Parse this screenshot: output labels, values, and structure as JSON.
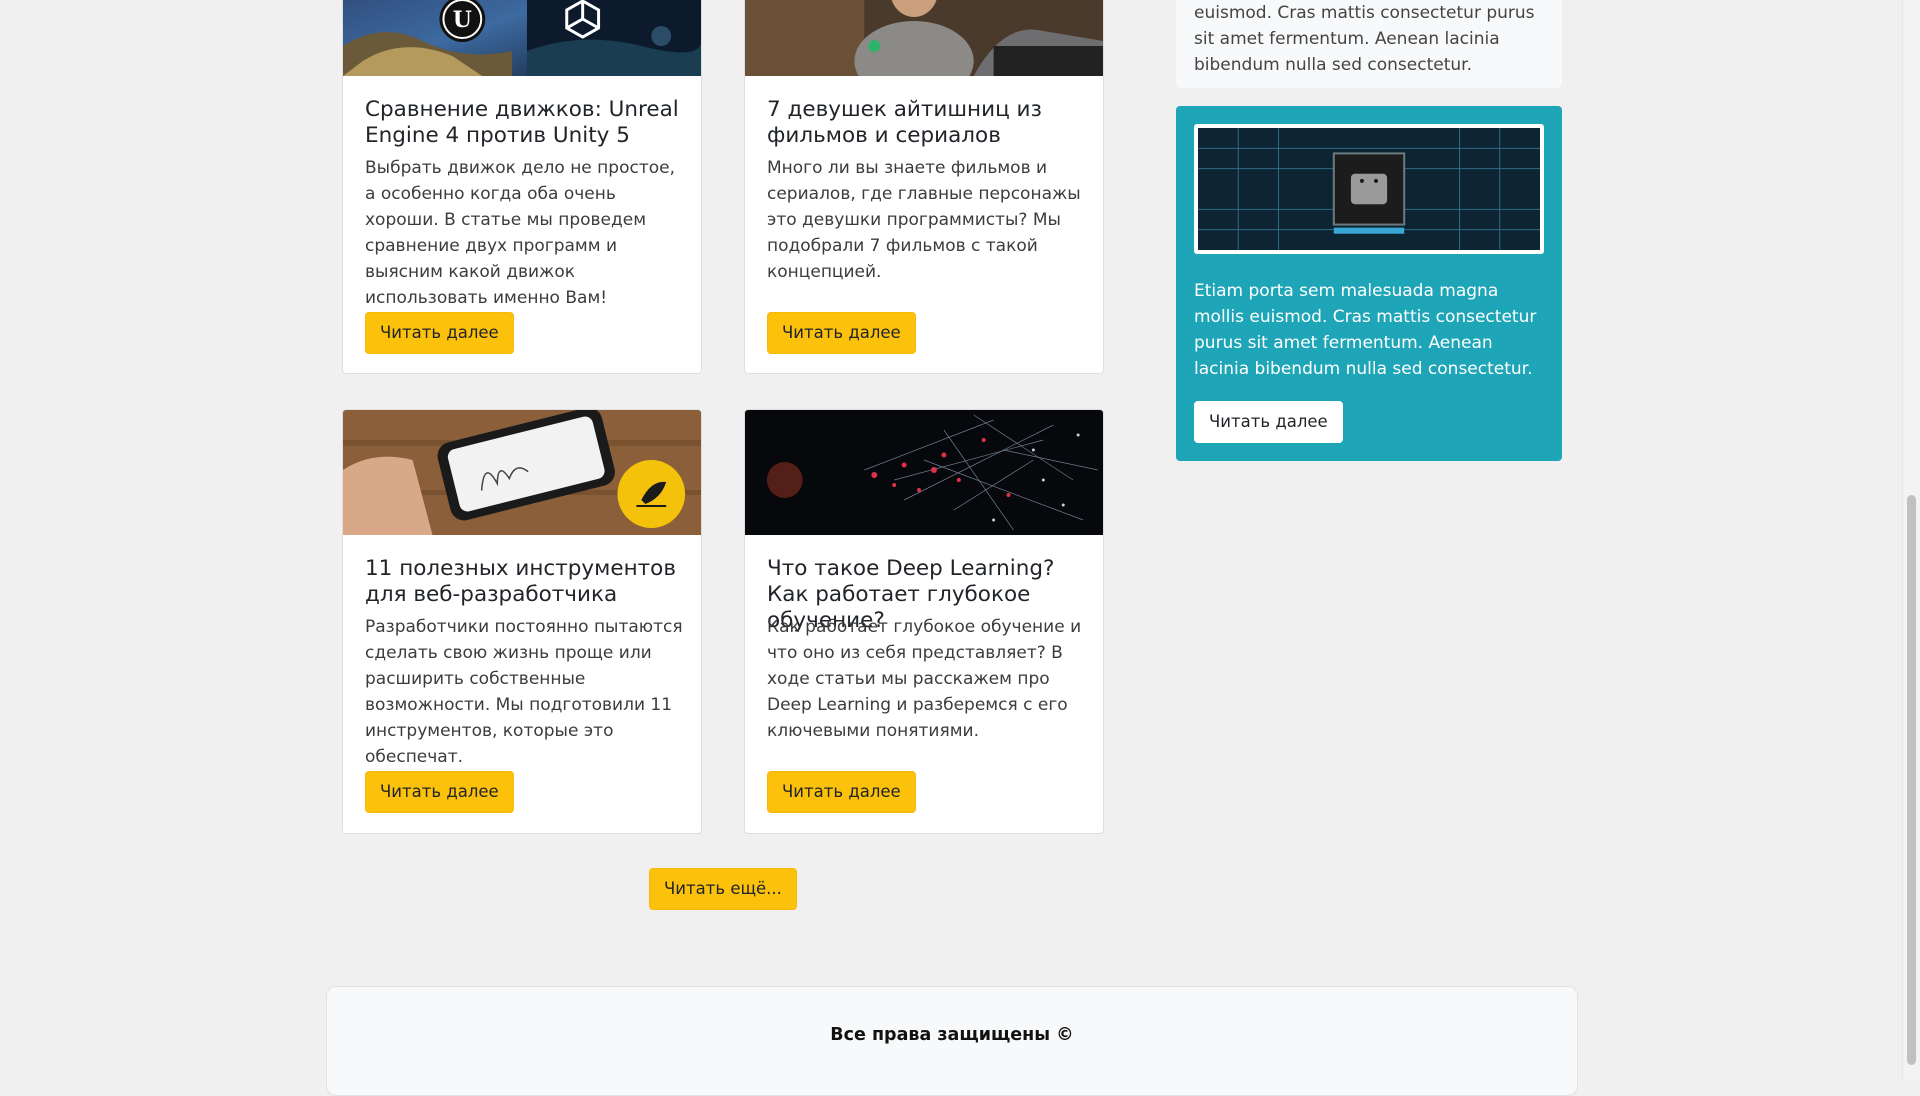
{
  "cards": [
    {
      "title": "Сравнение движков: Unreal Engine 4 против Unity 5",
      "text": "Выбрать движок дело не простое, а особенно когда оба очень хороши. В статье мы проведем сравнение двух программ и выясним какой движок использовать именно Вам!",
      "button": "Читать далее"
    },
    {
      "title": "7 девушек айтишниц из фильмов и сериалов",
      "text": "Много ли вы знаете фильмов и сериалов, где главные персонажы это девушки программисты? Мы подобрали 7 фильмов с такой концепцией.",
      "button": "Читать далее"
    },
    {
      "title": "11 полезных инструментов для веб-разработчика",
      "text": "Разработчики постоянно пытаются сделать свою жизнь проще или расширить собственные возможности. Мы подготовили 11 инструментов, которые это обеспечат.",
      "button": "Читать далее"
    },
    {
      "title": "Что такое Deep Learning? Как работает глубокое обучение?",
      "text": "Как работает глубокое обучение и что оно из себя представляет? В ходе статьи мы расскажем про Deep Learning и разберемся с его ключевыми понятиями.",
      "button": "Читать далее"
    }
  ],
  "load_more": "Читать ещё...",
  "sidebar": {
    "top_text": "euismod. Cras mattis consectetur purus sit amet fermentum. Aenean lacinia bibendum nulla sed consectetur.",
    "feature_text": "Etiam porta sem malesuada magna mollis euismod. Cras mattis consectetur purus sit amet fermentum. Aenean lacinia bibendum nulla sed consectetur.",
    "feature_button": "Читать далее"
  },
  "footer": {
    "copyright": "Все права защищены ©"
  },
  "colors": {
    "accent": "#fcc10b",
    "feature_bg": "#1ea5b7",
    "page_bg": "#f0f0f0"
  }
}
